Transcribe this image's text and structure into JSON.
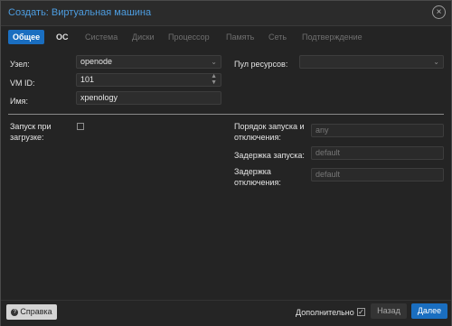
{
  "dialog": {
    "title": "Создать: Виртуальная машина"
  },
  "tabs": [
    {
      "label": "Общее"
    },
    {
      "label": "ОС"
    },
    {
      "label": "Система"
    },
    {
      "label": "Диски"
    },
    {
      "label": "Процессор"
    },
    {
      "label": "Память"
    },
    {
      "label": "Сеть"
    },
    {
      "label": "Подтверждение"
    }
  ],
  "form": {
    "node_label": "Узел:",
    "node_value": "openode",
    "vmid_label": "VM ID:",
    "vmid_value": "101",
    "name_label": "Имя:",
    "name_value": "xpenology",
    "pool_label": "Пул ресурсов:",
    "pool_value": "",
    "autostart_label_1": "Запуск при",
    "autostart_label_2": "загрузке:",
    "startup_order_label_1": "Порядок запуска и",
    "startup_order_label_2": "отключения:",
    "startup_order_placeholder": "any",
    "startup_delay_label": "Задержка запуска:",
    "startup_delay_placeholder": "default",
    "shutdown_delay_label_1": "Задержка",
    "shutdown_delay_label_2": "отключения:",
    "shutdown_delay_placeholder": "default"
  },
  "footer": {
    "help_label": "Справка",
    "advanced_label": "Дополнительно",
    "back_label": "Назад",
    "next_label": "Далее"
  },
  "colors": {
    "accent": "#1a6ec0",
    "title": "#4d9de0"
  }
}
